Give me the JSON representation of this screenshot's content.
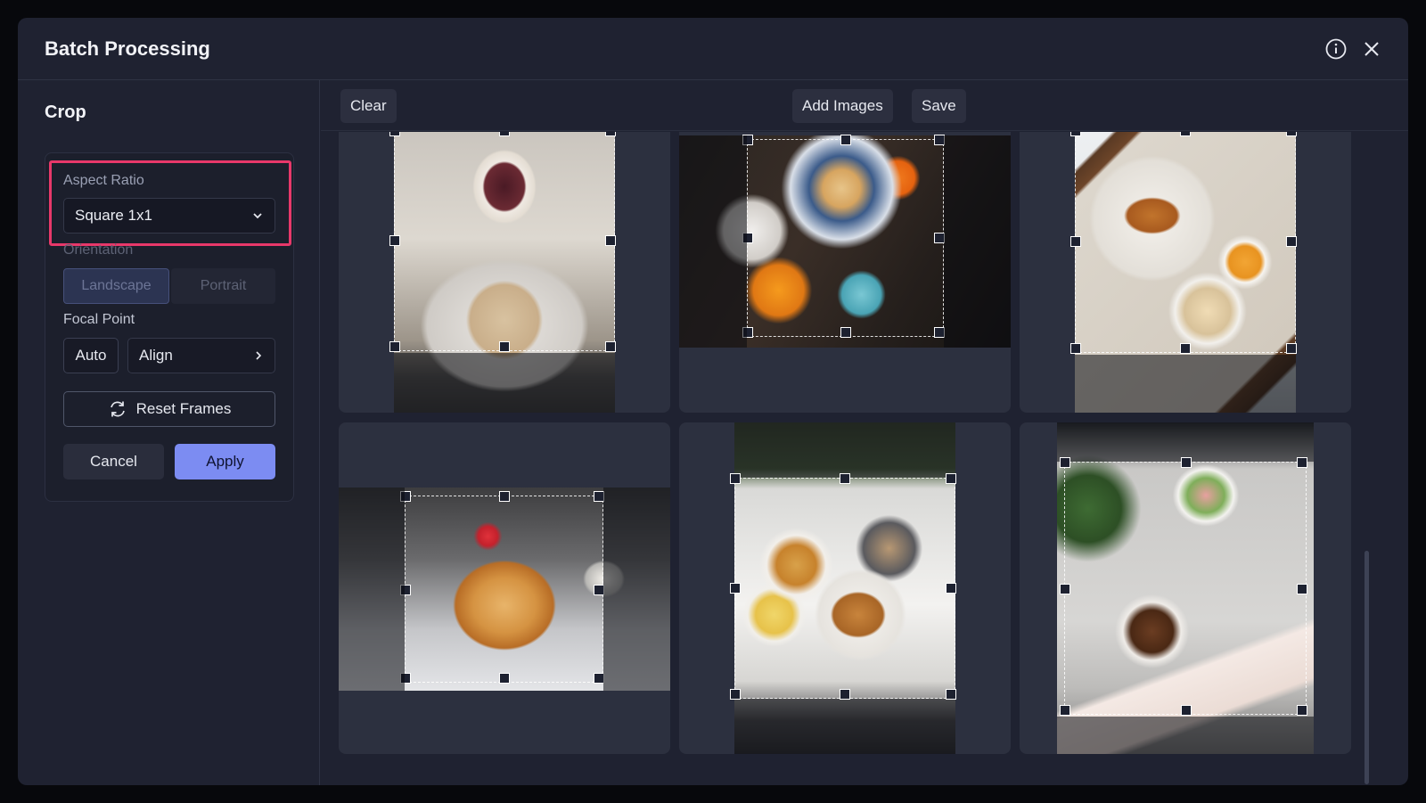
{
  "modal": {
    "title": "Batch Processing",
    "info_icon": "info-icon",
    "close_icon": "close-icon"
  },
  "sidebar": {
    "section_title": "Crop",
    "aspect_ratio_label": "Aspect Ratio",
    "aspect_ratio_value": "Square 1x1",
    "orientation_label": "Orientation",
    "orientation_options": [
      "Landscape",
      "Portrait"
    ],
    "orientation_selected": "Landscape",
    "focal_point_label": "Focal Point",
    "focal_auto_label": "Auto",
    "focal_align_label": "Align",
    "reset_frames_label": "Reset Frames",
    "cancel_label": "Cancel",
    "apply_label": "Apply"
  },
  "toolbar": {
    "clear_label": "Clear",
    "add_images_label": "Add Images",
    "save_label": "Save"
  },
  "images": [
    {
      "subject": "tea-cup-and-cakes"
    },
    {
      "subject": "overhead-brunch-table"
    },
    {
      "subject": "croissant-breakfast-tray"
    },
    {
      "subject": "pancake-stack"
    },
    {
      "subject": "waffles-and-croissants"
    },
    {
      "subject": "salad-and-coffee"
    }
  ],
  "colors": {
    "accent": "#7c8cf2",
    "highlight": "#e8386a",
    "modal_bg": "#1f2231",
    "card_bg": "#2c303f"
  }
}
